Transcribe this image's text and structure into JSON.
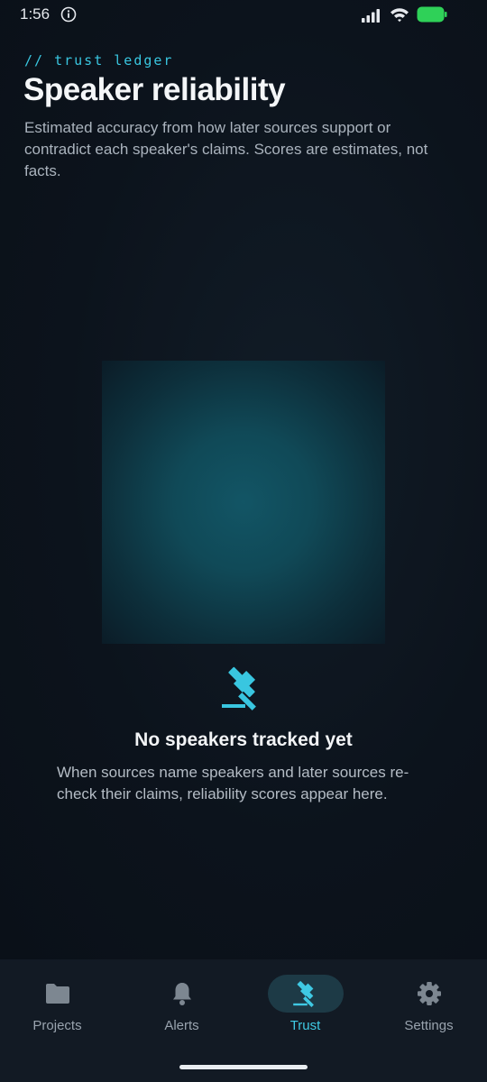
{
  "status_bar": {
    "time": "1:56",
    "icons": [
      "info-icon",
      "signal-icon",
      "wifi-icon",
      "battery-icon"
    ],
    "battery_color": "#2fd158"
  },
  "header": {
    "kicker": "// trust ledger",
    "title": "Speaker reliability",
    "subtitle": "Estimated accuracy from how later sources support or contradict each speaker's claims. Scores are estimates, not facts."
  },
  "empty_state": {
    "icon": "gavel-icon",
    "title": "No speakers tracked yet",
    "body": "When sources name speakers and later sources re-check their claims, reliability scores appear here."
  },
  "bottom_nav": {
    "items": [
      {
        "label": "Projects",
        "icon": "folder-icon",
        "active": false
      },
      {
        "label": "Alerts",
        "icon": "bell-icon",
        "active": false
      },
      {
        "label": "Trust",
        "icon": "gavel-icon",
        "active": true
      },
      {
        "label": "Settings",
        "icon": "gear-icon",
        "active": false
      }
    ]
  },
  "colors": {
    "accent": "#3fc9e3",
    "background": "#0d141d",
    "nav_background": "#121a24",
    "active_pill": "#1d3a46"
  }
}
